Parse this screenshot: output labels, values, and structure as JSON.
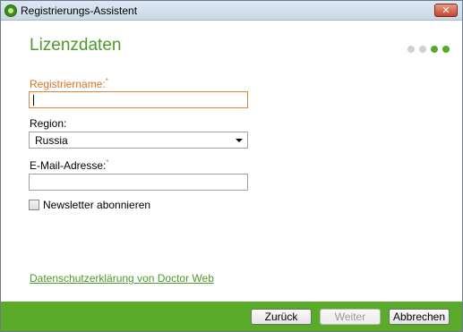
{
  "window": {
    "title": "Registrierungs-Assistent",
    "close_glyph": "✕"
  },
  "page": {
    "title": "Lizenzdaten",
    "steps_total": 4,
    "current_step": 3
  },
  "form": {
    "registrant_label": "Registriername:",
    "registrant_value": "",
    "required_marker": "*",
    "region_label": "Region:",
    "region_value": "Russia",
    "email_label": "E-Mail-Adresse:",
    "email_value": "",
    "newsletter_label": "Newsletter abonnieren",
    "newsletter_checked": false
  },
  "privacy_link": "Datenschutzerklärung von Doctor Web",
  "buttons": {
    "back": "Zurück",
    "next": "Weiter",
    "cancel": "Abbrechen"
  },
  "colors": {
    "accent": "#4c9a2a",
    "footer": "#5aab2a",
    "required": "#d9732a"
  }
}
